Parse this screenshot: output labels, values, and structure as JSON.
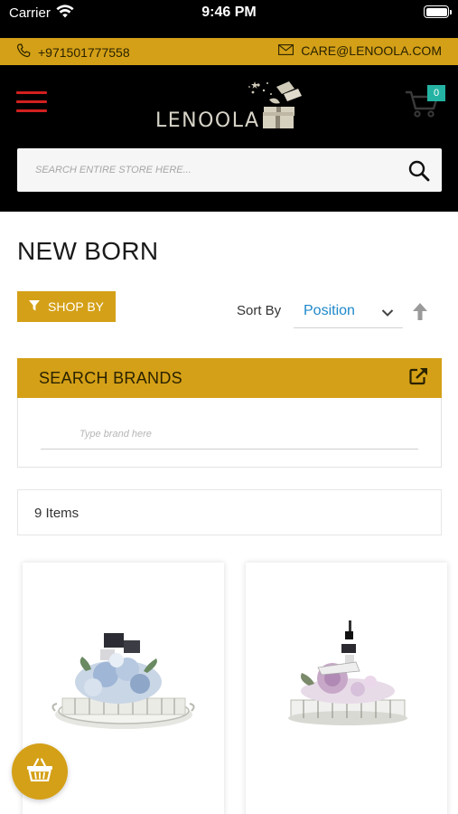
{
  "status_bar": {
    "carrier": "Carrier",
    "time": "9:46 PM"
  },
  "contact": {
    "phone": "+971501777558",
    "email": "CARE@LENOOLA.COM"
  },
  "header": {
    "logo_text": "LENOOLA",
    "cart_count": "0",
    "search_placeholder": "Search entire store here..."
  },
  "page": {
    "title": "NEW BORN"
  },
  "toolbar": {
    "shop_by_label": "SHOP BY",
    "sort_by_label": "Sort By",
    "sort_value": "Position"
  },
  "brands": {
    "title": "SEARCH BRANDS",
    "input_placeholder": "Type brand here"
  },
  "items": {
    "count_label": "9 Items"
  },
  "colors": {
    "accent": "#d4a017",
    "header_bg": "#000000",
    "menu_icon": "#d21f1f",
    "cart_badge": "#24b3a3",
    "sort_value": "#1e88c9"
  },
  "icons": [
    "wifi-icon",
    "battery-icon",
    "phone-icon",
    "mail-icon",
    "menu-icon",
    "cart-icon",
    "search-icon",
    "filter-icon",
    "chevron-down-icon",
    "sort-arrow-up-icon",
    "external-link-icon",
    "basket-icon"
  ]
}
